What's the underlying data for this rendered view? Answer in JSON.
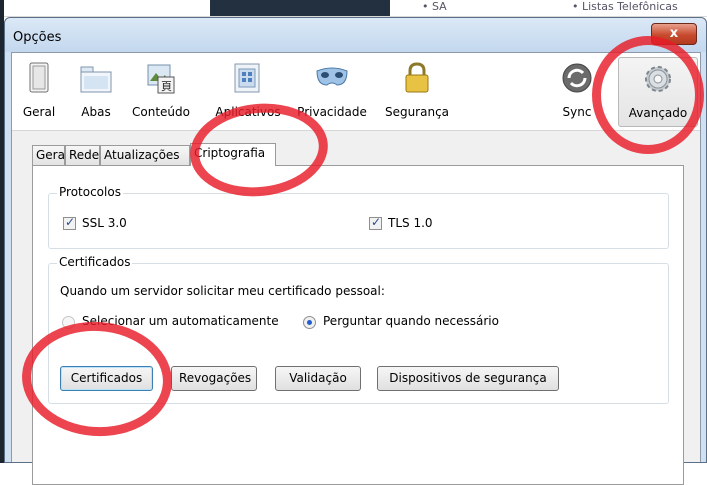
{
  "background": {
    "texts": [
      "• SA",
      "• Listas Telefônicas"
    ]
  },
  "window": {
    "title": "Opções",
    "close_label": "x"
  },
  "toolbar": {
    "items": [
      {
        "label": "Geral",
        "icon": "switch-icon"
      },
      {
        "label": "Abas",
        "icon": "tabs-icon"
      },
      {
        "label": "Conteúdo",
        "icon": "content-icon"
      },
      {
        "label": "Aplicativos",
        "icon": "applications-icon"
      },
      {
        "label": "Privacidade",
        "icon": "mask-icon"
      },
      {
        "label": "Segurança",
        "icon": "lock-icon"
      },
      {
        "label": "Sync",
        "icon": "sync-icon"
      },
      {
        "label": "Avançado",
        "icon": "gear-icon",
        "selected": true
      }
    ]
  },
  "tabs": [
    {
      "label": "Geral"
    },
    {
      "label": "Rede"
    },
    {
      "label": "Atualizações"
    },
    {
      "label": "Criptografia",
      "active": true
    }
  ],
  "protocols": {
    "title": "Protocolos",
    "ssl": {
      "label": "SSL 3.0",
      "checked": true
    },
    "tls": {
      "label": "TLS 1.0",
      "checked": true
    }
  },
  "certificates": {
    "title": "Certificados",
    "prompt": "Quando um servidor solicitar meu certificado pessoal:",
    "radio_auto": {
      "label": "Selecionar um automaticamente",
      "selected": false
    },
    "radio_ask": {
      "label": "Perguntar quando necessário",
      "selected": true
    },
    "buttons": {
      "certificates": "Certificados",
      "revocations": "Revogações",
      "validation": "Validação",
      "devices": "Dispositivos de segurança"
    }
  },
  "colors": {
    "annotation": "#e81c28",
    "titlebar": "#c3d8ee",
    "close": "#c74a2e"
  }
}
